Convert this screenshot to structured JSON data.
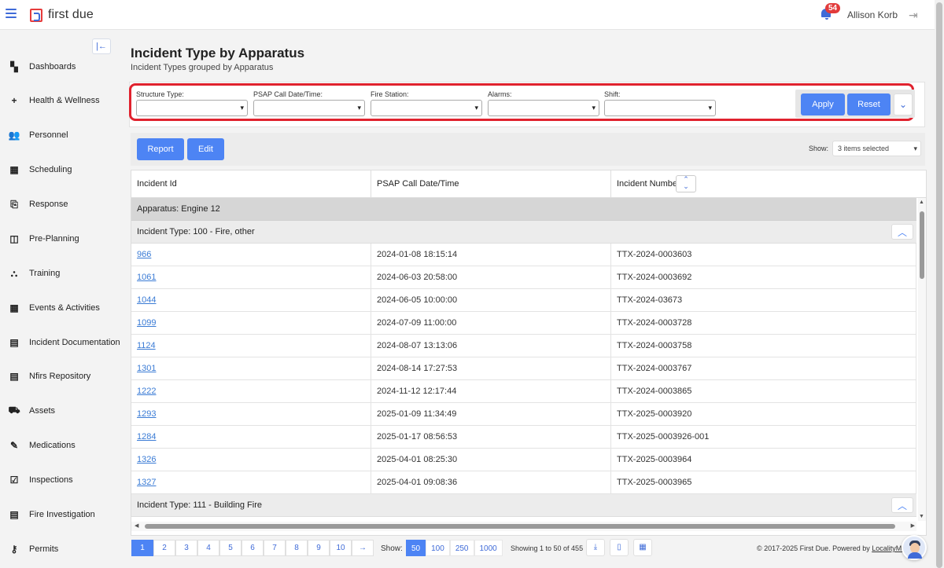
{
  "app": {
    "logo_text": "first due"
  },
  "header": {
    "notification_count": "54",
    "user_name": "Allison Korb"
  },
  "sidebar": {
    "items": [
      {
        "label": "Dashboards",
        "icon": "dashboard-icon"
      },
      {
        "label": "Health & Wellness",
        "icon": "plus-icon"
      },
      {
        "label": "Personnel",
        "icon": "people-icon"
      },
      {
        "label": "Scheduling",
        "icon": "calendar-icon"
      },
      {
        "label": "Response",
        "icon": "response-icon"
      },
      {
        "label": "Pre-Planning",
        "icon": "map-icon"
      },
      {
        "label": "Training",
        "icon": "training-icon"
      },
      {
        "label": "Events & Activities",
        "icon": "calendar-icon"
      },
      {
        "label": "Incident Documentation",
        "icon": "document-icon"
      },
      {
        "label": "Nfirs Repository",
        "icon": "document-icon"
      },
      {
        "label": "Assets",
        "icon": "truck-icon"
      },
      {
        "label": "Medications",
        "icon": "syringe-icon"
      },
      {
        "label": "Inspections",
        "icon": "clipboard-check-icon"
      },
      {
        "label": "Fire Investigation",
        "icon": "document-icon"
      },
      {
        "label": "Permits",
        "icon": "key-icon"
      }
    ]
  },
  "page": {
    "title": "Incident Type by Apparatus",
    "subtitle": "Incident Types grouped by Apparatus"
  },
  "filters": {
    "structure_type": "Structure Type:",
    "psap_call": "PSAP Call Date/Time:",
    "fire_station": "Fire Station:",
    "alarms": "Alarms:",
    "shift": "Shift:",
    "apply": "Apply",
    "reset": "Reset"
  },
  "toolbar": {
    "report": "Report",
    "edit": "Edit",
    "show_label": "Show:",
    "show_value": "3 items selected"
  },
  "table": {
    "columns": [
      "Incident Id",
      "PSAP Call Date/Time",
      "Incident Number"
    ],
    "apparatus_group": "Apparatus: Engine 12",
    "type_group_1": "Incident Type: 100 - Fire, other",
    "type_group_2": "Incident Type: 111 - Building Fire",
    "rows": [
      {
        "id": "966",
        "date": "2024-01-08 18:15:14",
        "number": "TTX-2024-0003603"
      },
      {
        "id": "1061",
        "date": "2024-06-03 20:58:00",
        "number": "TTX-2024-0003692"
      },
      {
        "id": "1044",
        "date": "2024-06-05 10:00:00",
        "number": "TTX-2024-03673"
      },
      {
        "id": "1099",
        "date": "2024-07-09 11:00:00",
        "number": "TTX-2024-0003728"
      },
      {
        "id": "1124",
        "date": "2024-08-07 13:13:06",
        "number": "TTX-2024-0003758"
      },
      {
        "id": "1301",
        "date": "2024-08-14 17:27:53",
        "number": "TTX-2024-0003767"
      },
      {
        "id": "1222",
        "date": "2024-11-12 12:17:44",
        "number": "TTX-2024-0003865"
      },
      {
        "id": "1293",
        "date": "2025-01-09 11:34:49",
        "number": "TTX-2025-0003920"
      },
      {
        "id": "1284",
        "date": "2025-01-17 08:56:53",
        "number": "TTX-2025-0003926-001"
      },
      {
        "id": "1326",
        "date": "2025-04-01 08:25:30",
        "number": "TTX-2025-0003964"
      },
      {
        "id": "1327",
        "date": "2025-04-01 09:08:36",
        "number": "TTX-2025-0003965"
      }
    ]
  },
  "pagination": {
    "pages": [
      "1",
      "2",
      "3",
      "4",
      "5",
      "6",
      "7",
      "8",
      "9",
      "10",
      "→"
    ],
    "show_label": "Show:",
    "per_page": [
      "50",
      "100",
      "250",
      "1000"
    ],
    "showing": "Showing 1 to 50 of 455"
  },
  "footer": {
    "copyright": "© 2017-2025 First Due. Powered by ",
    "powered_link": "LocalityMe"
  }
}
